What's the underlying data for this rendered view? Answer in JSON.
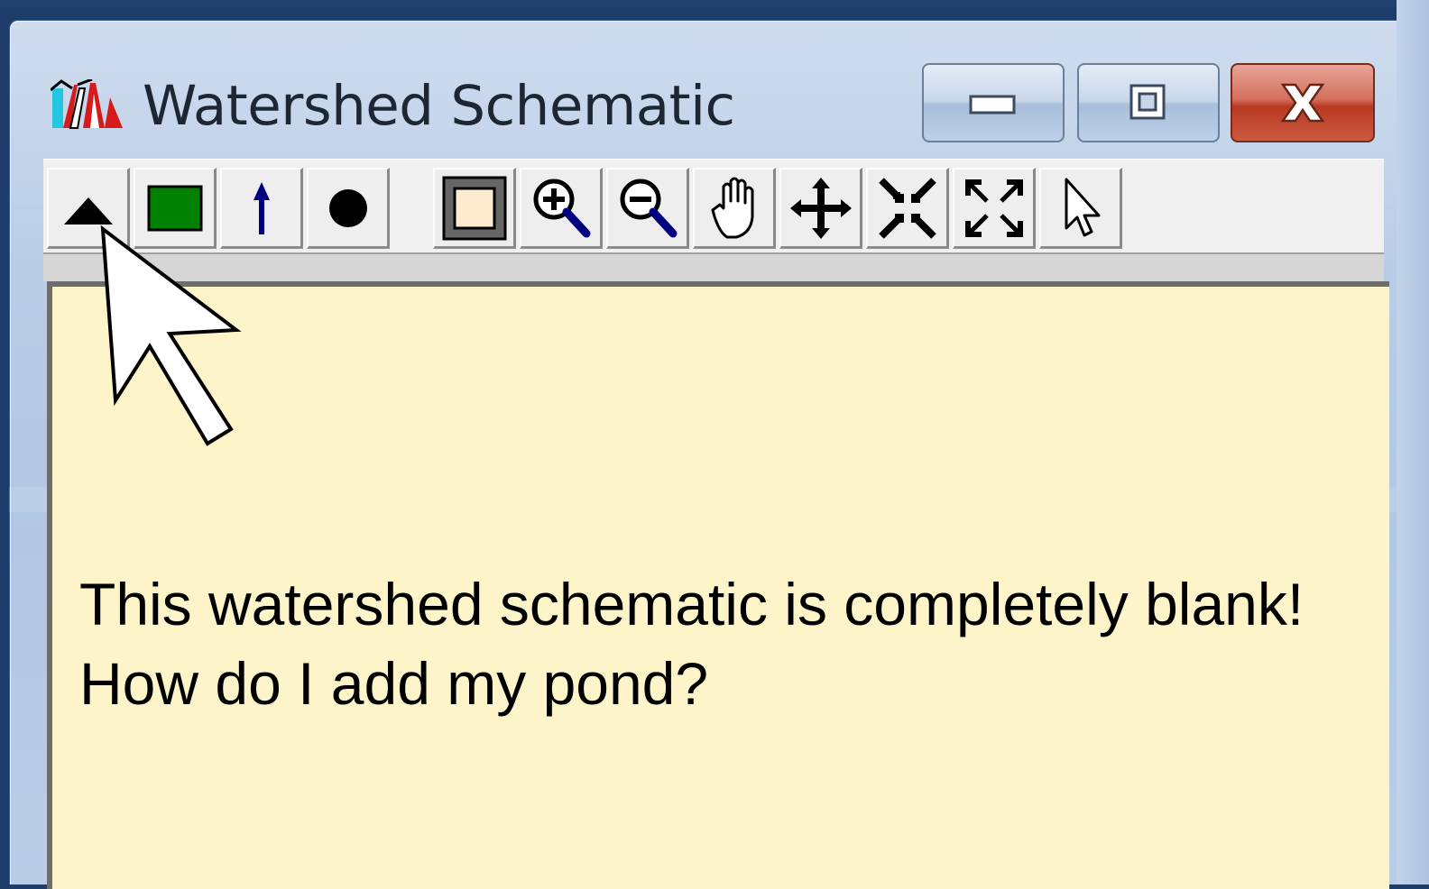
{
  "window": {
    "title": "Watershed Schematic",
    "icon": "watershed-app-icon"
  },
  "controls": {
    "minimize_icon": "minimize-icon",
    "maximize_icon": "maximize-icon",
    "close_icon": "close-icon"
  },
  "toolbar": {
    "tools": [
      {
        "name": "add-subarea-tool",
        "icon": "triangle-icon"
      },
      {
        "name": "add-pond-tool",
        "icon": "green-rectangle-icon"
      },
      {
        "name": "add-reach-tool",
        "icon": "blue-pin-icon"
      },
      {
        "name": "add-link-tool",
        "icon": "black-dot-icon"
      },
      {
        "name": "frame-tool",
        "icon": "frame-icon"
      },
      {
        "name": "zoom-in-tool",
        "icon": "zoom-in-icon"
      },
      {
        "name": "zoom-out-tool",
        "icon": "zoom-out-icon"
      },
      {
        "name": "pan-tool",
        "icon": "hand-icon"
      },
      {
        "name": "move-tool",
        "icon": "move-arrows-icon"
      },
      {
        "name": "shrink-tool",
        "icon": "shrink-arrows-icon"
      },
      {
        "name": "expand-tool",
        "icon": "expand-arrows-icon"
      },
      {
        "name": "select-tool",
        "icon": "cursor-icon"
      }
    ]
  },
  "canvas": {
    "background": "#fdf5c9",
    "message_line1": "This watershed schematic is completely blank!",
    "message_line2": "How do I add my pond?"
  },
  "colors": {
    "pond_green": "#008000",
    "reach_blue": "#000080",
    "close_red": "#c0442c"
  }
}
